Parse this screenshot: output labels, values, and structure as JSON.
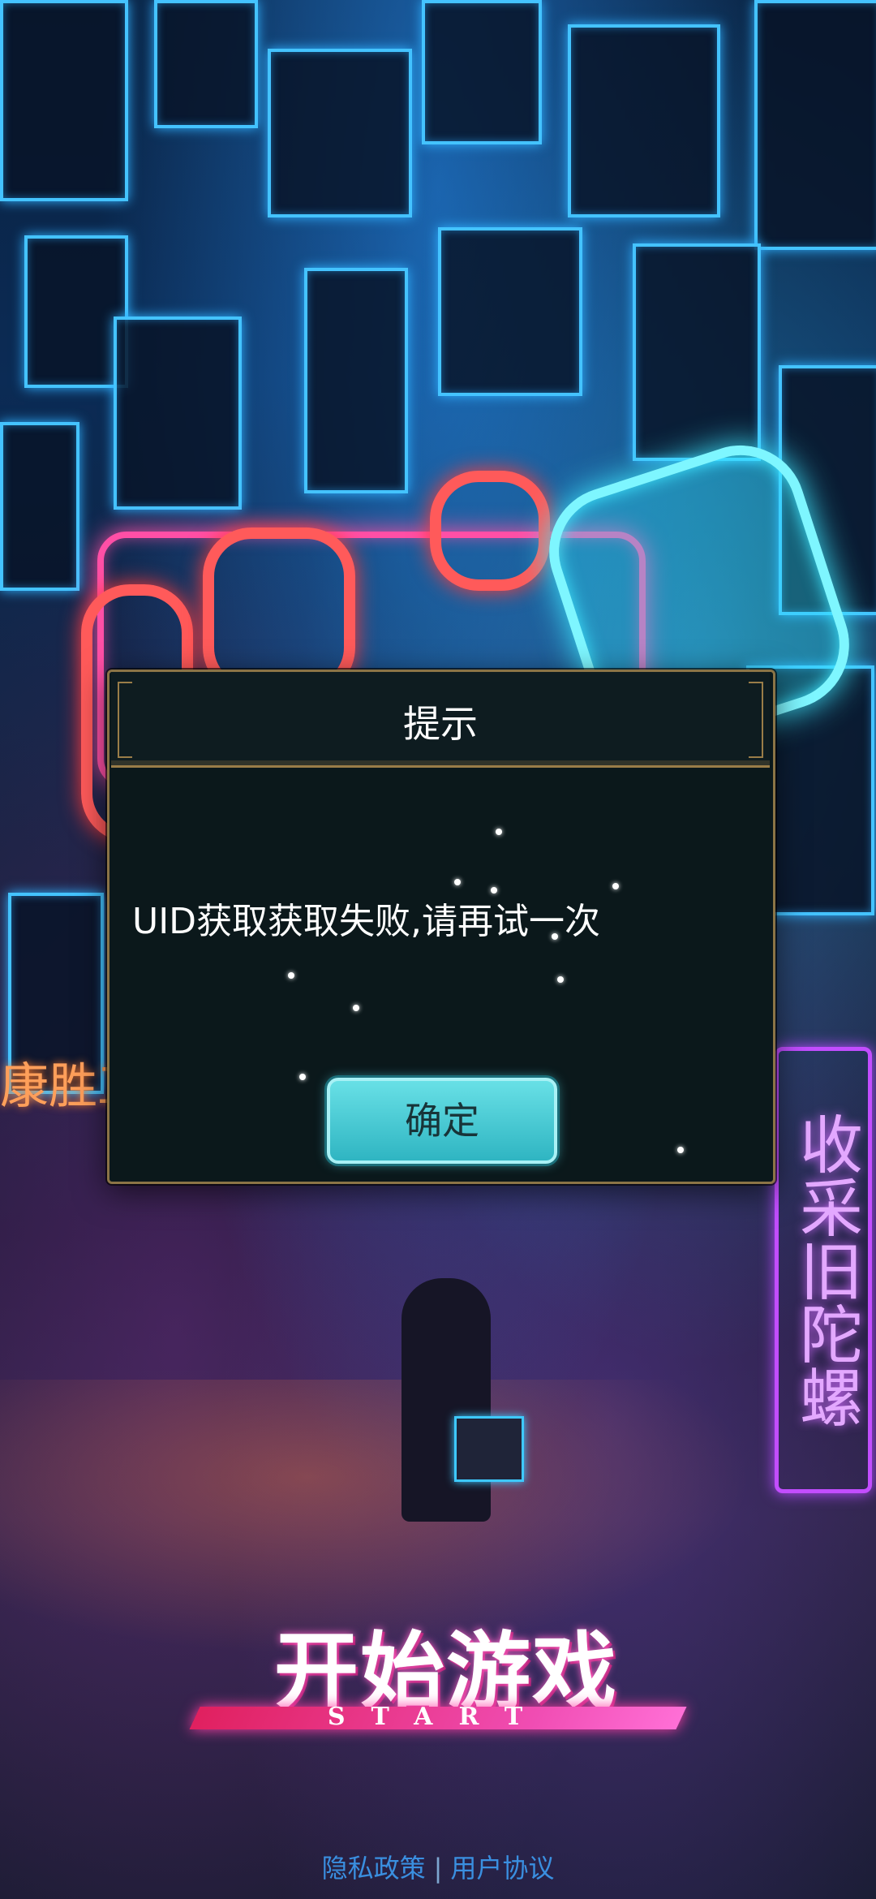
{
  "game": {
    "start_title": "开始游戏",
    "start_subtitle": "START"
  },
  "dialog": {
    "title": "提示",
    "message": "UID获取获取失败,请再试一次",
    "confirm_label": "确定"
  },
  "footer": {
    "privacy_label": "隐私政策",
    "separator": "|",
    "terms_label": "用户协议"
  },
  "signs": {
    "vertical_sign": "收采旧陀螺",
    "side_sign": "康胜工"
  },
  "colors": {
    "neon_pink": "#ff4fa6",
    "neon_cyan": "#44c3ff",
    "dialog_border": "#9a7d48",
    "confirm_button": "#4fcfd8",
    "link_blue": "#3a8fe0"
  }
}
